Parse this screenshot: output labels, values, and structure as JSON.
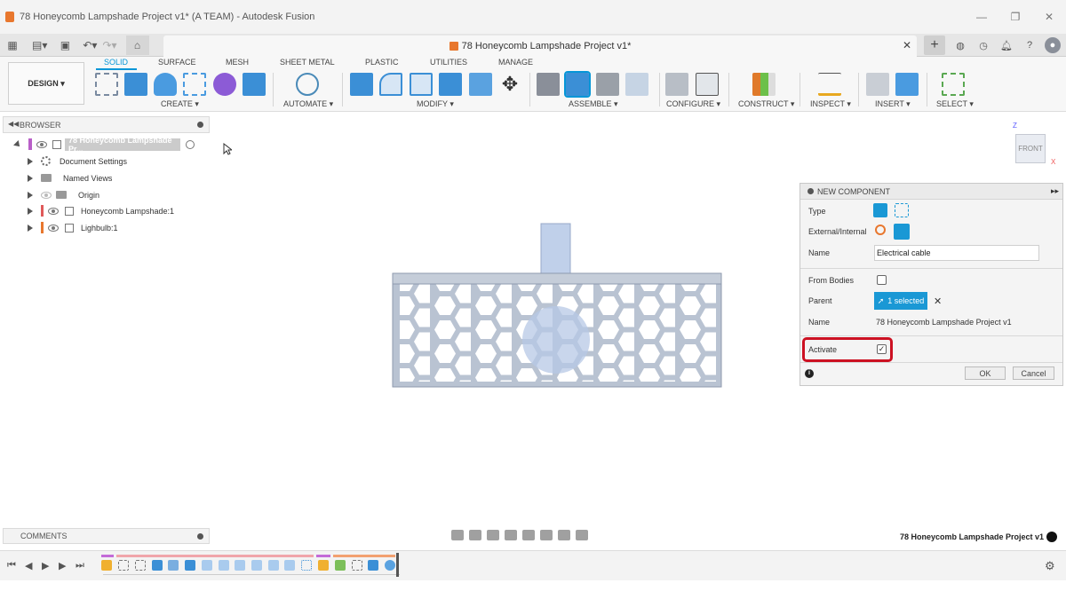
{
  "window": {
    "title": "78 Honeycomb Lampshade Project v1* (A TEAM) - Autodesk Fusion",
    "minimize": "—",
    "maximize": "❐",
    "close": "✕"
  },
  "doc_tab": {
    "title": "78 Honeycomb Lampshade Project v1*",
    "close": "✕"
  },
  "design_button": "DESIGN ▾",
  "ribbon_tabs": [
    "SOLID",
    "SURFACE",
    "MESH",
    "SHEET METAL",
    "PLASTIC",
    "UTILITIES",
    "MANAGE"
  ],
  "ribbon_groups": [
    "CREATE ▾",
    "AUTOMATE ▾",
    "MODIFY ▾",
    "ASSEMBLE ▾",
    "CONFIGURE ▾",
    "CONSTRUCT ▾",
    "INSPECT ▾",
    "INSERT ▾",
    "SELECT ▾"
  ],
  "browser": {
    "title": "BROWSER",
    "root": "78 Honeycomb Lampshade Pr...",
    "items": [
      "Document Settings",
      "Named Views",
      "Origin",
      "Honeycomb Lampshade:1",
      "Lighbulb:1"
    ]
  },
  "viewcube": {
    "face": "FRONT",
    "z": "Z",
    "x": "X"
  },
  "dialog": {
    "title": "NEW COMPONENT",
    "type_label": "Type",
    "ext_label": "External/Internal",
    "name_label": "Name",
    "name_value": "Electrical cable",
    "from_bodies_label": "From Bodies",
    "parent_label": "Parent",
    "parent_value": "1 selected",
    "parent_name_label": "Name",
    "parent_name_value": "78 Honeycomb Lampshade Project v1",
    "activate_label": "Activate",
    "activate_checked": true,
    "ok": "OK",
    "cancel": "Cancel",
    "info": "i"
  },
  "comments": {
    "title": "COMMENTS"
  },
  "status": {
    "project_name": "78 Honeycomb Lampshade Project v1"
  },
  "colors": {
    "accent": "#0696d7",
    "highlight": "#cc1122",
    "model": "#b9c6db"
  }
}
